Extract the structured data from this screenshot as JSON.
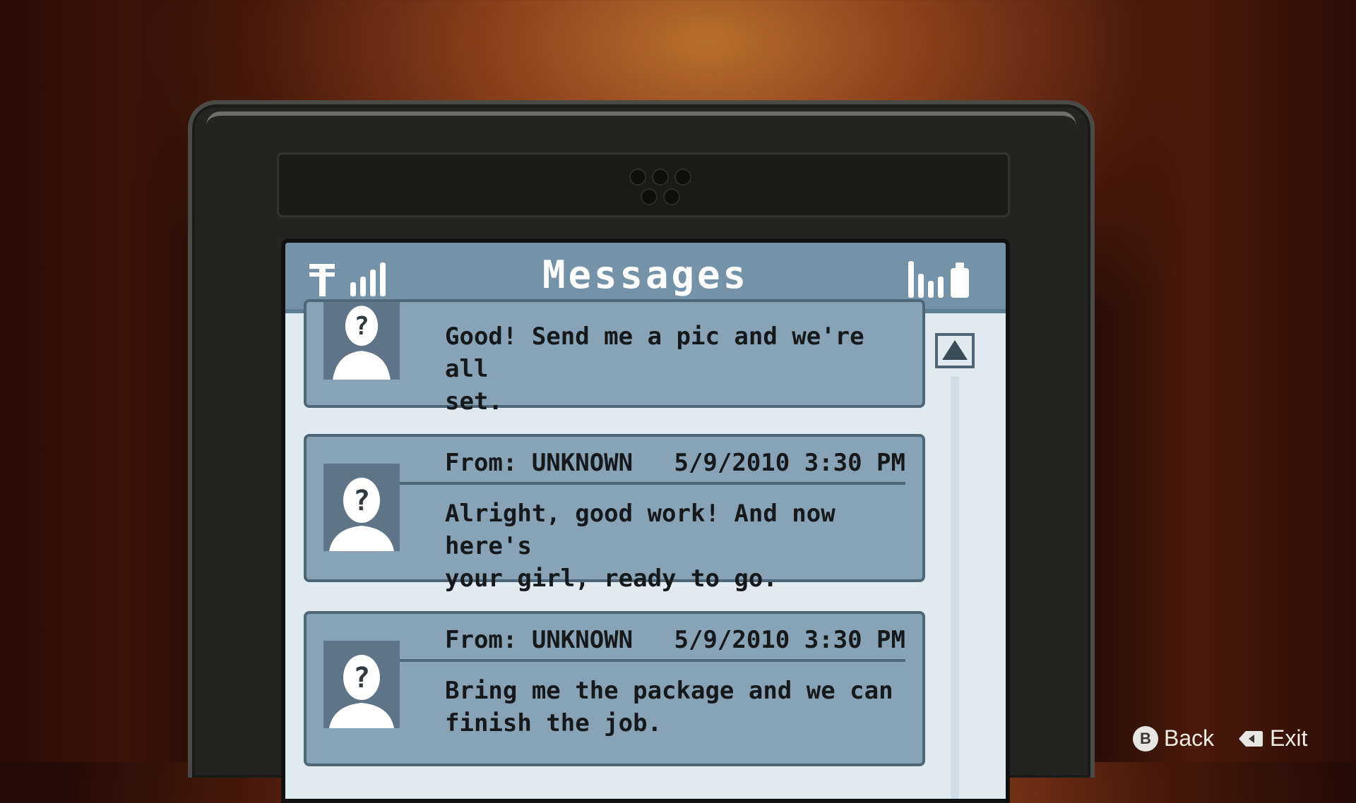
{
  "phone": {
    "title": "Messages"
  },
  "messages": [
    {
      "from": "",
      "timestamp": "",
      "text": "Good! Send me a pic and we're all\nset."
    },
    {
      "from": "From: UNKNOWN",
      "timestamp": "5/9/2010 3:30 PM",
      "text": "Alright, good work! And now here's\nyour girl, ready to go."
    },
    {
      "from": "From: UNKNOWN",
      "timestamp": "5/9/2010 3:30 PM",
      "text": "Bring me the package and we can\nfinish the job."
    }
  ],
  "controls": {
    "back_label": "Back",
    "back_button": "B",
    "exit_label": "Exit"
  },
  "icons": {
    "network": "carrier-icon",
    "signal": "signal-bars-icon",
    "volume": "volume-bars-icon",
    "battery": "battery-icon",
    "scroll": "scroll-up-arrow-icon",
    "avatar": "unknown-contact-icon"
  },
  "colors": {
    "statusbar": "#7593a8",
    "message_bg": "#89a3b6",
    "screen_bg": "#dfeaf1"
  }
}
